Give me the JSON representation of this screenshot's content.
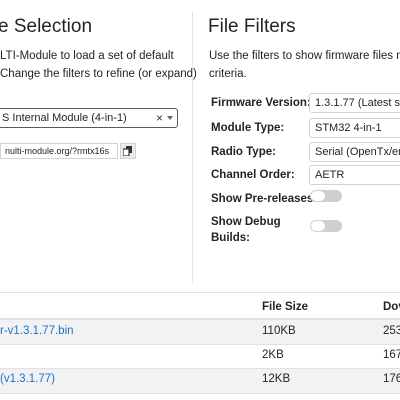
{
  "left": {
    "heading": "e Selection",
    "desc_line1": "LTI-Module to load a set of default",
    "desc_line2": "Change the filters to refine (or expand)",
    "module_select_value": "S Internal Module (4-in-1)",
    "share_link": "nulti-module.org/?rmtx16s"
  },
  "right": {
    "heading": "File Filters",
    "desc_line1": "Use the filters to show firmware files mat",
    "desc_line2": "criteria.",
    "filters": {
      "firmware_version": {
        "label": "Firmware Version:",
        "value": "1.3.1.77 (Latest st"
      },
      "module_type": {
        "label": "Module Type:",
        "value": "STM32 4-in-1"
      },
      "radio_type": {
        "label": "Radio Type:",
        "value": "Serial (OpenTx/erS"
      },
      "channel_order": {
        "label": "Channel Order:",
        "value": "AETR"
      },
      "show_prereleases": {
        "label": "Show Pre-releases:",
        "on": false
      },
      "show_debug": {
        "label_line1": "Show Debug",
        "label_line2": "Builds:",
        "on": false
      }
    }
  },
  "table": {
    "headers": {
      "file_size": "File Size",
      "downloads": "Dov"
    },
    "rows": [
      {
        "name": "r-v1.3.1.77.bin",
        "size": "110KB",
        "downloads": "253"
      },
      {
        "name": "",
        "size": "2KB",
        "downloads": "167"
      },
      {
        "name": "(v1.3.1.77)",
        "size": "12KB",
        "downloads": "176"
      }
    ]
  },
  "colors": {
    "link": "#1a73c8",
    "stripe": "#f2f2f2"
  }
}
